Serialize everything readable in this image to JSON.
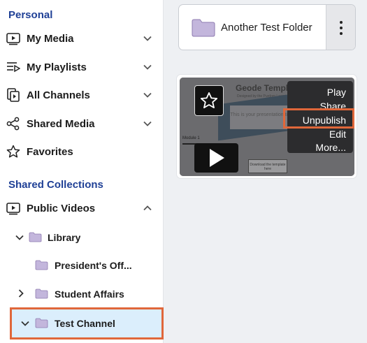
{
  "sidebar": {
    "personal_heading": "Personal",
    "items": [
      {
        "label": "My Media",
        "icon": "my-media-icon"
      },
      {
        "label": "My Playlists",
        "icon": "playlist-icon"
      },
      {
        "label": "All Channels",
        "icon": "channels-icon"
      },
      {
        "label": "Shared Media",
        "icon": "share-icon"
      },
      {
        "label": "Favorites",
        "icon": "star-icon"
      }
    ],
    "shared_heading": "Shared Collections",
    "public_videos": {
      "label": "Public Videos",
      "icon": "video-icon"
    },
    "tree": [
      {
        "label": "Library"
      },
      {
        "label": "President's Off..."
      },
      {
        "label": "Student Affairs"
      },
      {
        "label": "Test Channel"
      }
    ]
  },
  "main": {
    "folder_card": {
      "label": "Another Test Folder"
    },
    "media_card": {
      "thumbnail_title": "Geode Template",
      "thumbnail_subtitle": "Designed by the Purdom Learning",
      "thumbnail_panel_text": "This is your presentation title",
      "thumbnail_module": "Module 1",
      "thumbnail_button": "Download the template here"
    },
    "context_menu": [
      "Play",
      "Share",
      "Unpublish",
      "Edit",
      "More..."
    ]
  },
  "colors": {
    "heading_blue": "#1f4096",
    "highlight_orange": "#e0673a",
    "selected_bg": "#dbeefc",
    "folder_purple": "#8e7bb0"
  }
}
